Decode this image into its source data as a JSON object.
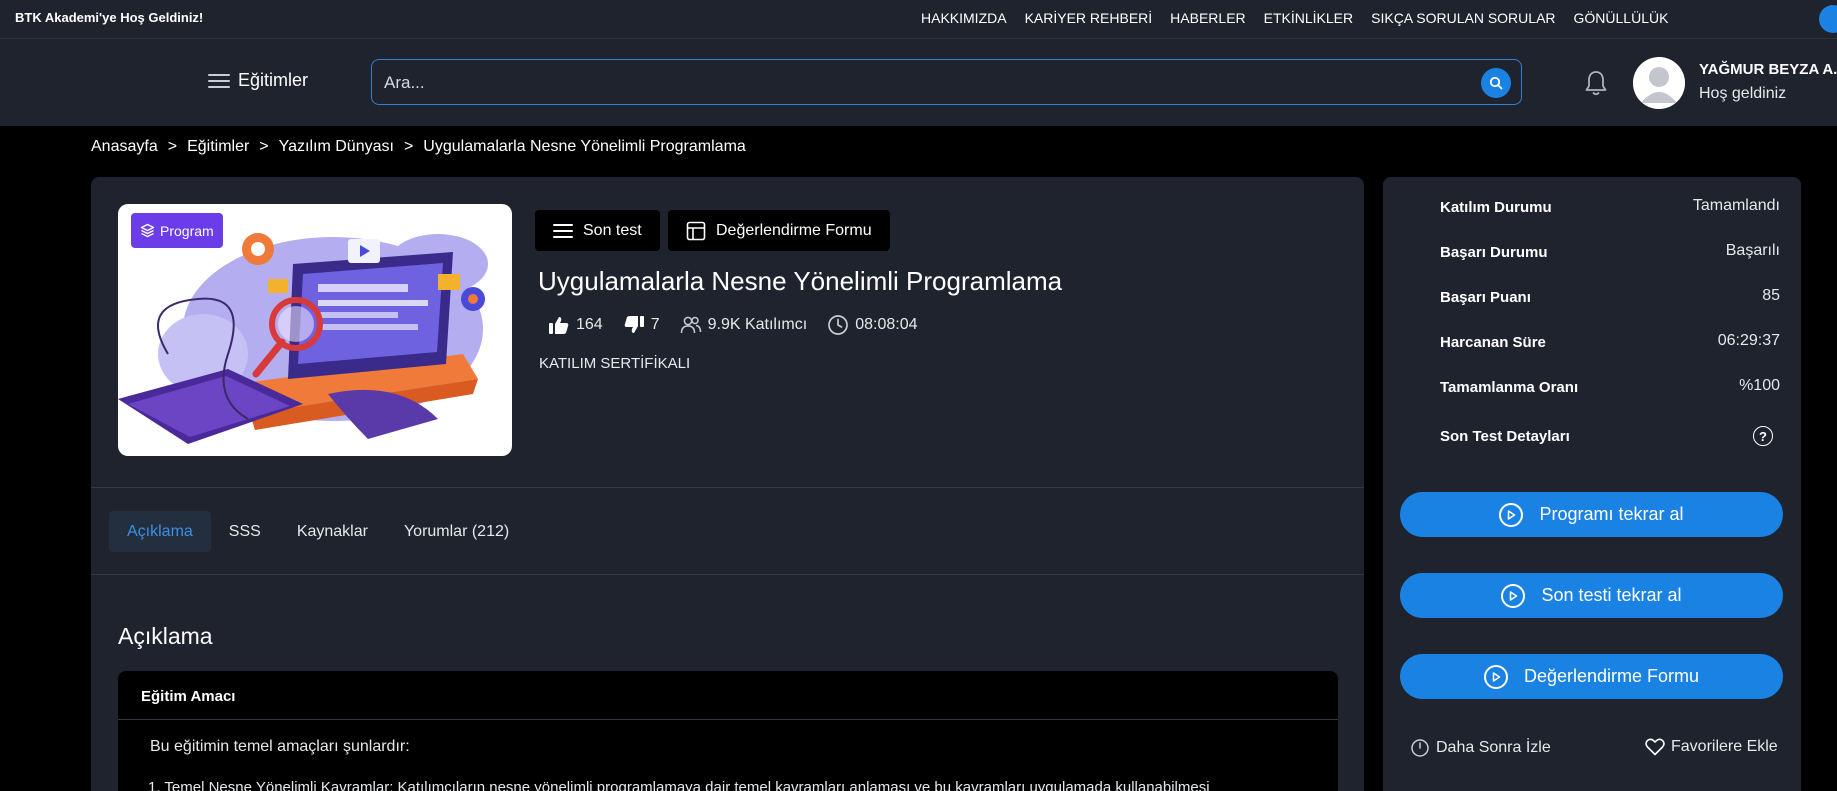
{
  "topbar": {
    "welcome": "BTK Akademi'ye Hoş Geldiniz!",
    "nav": [
      "HAKKIMIZDA",
      "KARİYER REHBERİ",
      "HABERLER",
      "ETKİNLİKLER",
      "SIKÇA SORULAN SORULAR",
      "GÖNÜLLÜLÜK"
    ]
  },
  "header": {
    "menu_label": "Eğitimler",
    "search_placeholder": "Ara...",
    "user_name": "YAĞMUR BEYZA A...",
    "user_greeting": "Hoş geldiniz"
  },
  "breadcrumb": [
    "Anasayfa",
    ">",
    "Eğitimler",
    ">",
    "Yazılım Dünyası",
    ">",
    "Uygulamalarla Nesne Yönelimli Programlama"
  ],
  "course": {
    "badge": "Program",
    "son_test_label": "Son test",
    "form_label": "Değerlendirme Formu",
    "title": "Uygulamalarla Nesne Yönelimli Programlama",
    "likes": "164",
    "dislikes": "7",
    "participants": "9.9K Katılımcı",
    "duration": "08:08:04",
    "certificate": "KATILIM SERTİFİKALI"
  },
  "tabs": [
    "Açıklama",
    "SSS",
    "Kaynaklar",
    "Yorumlar (212)"
  ],
  "description": {
    "heading": "Açıklama",
    "card_title": "Eğitim Amacı",
    "intro": "Bu eğitimin temel amaçları şunlardır:",
    "first_item": "1.  Temel Nesne Yönelimli Kavramlar: Katılımcıların nesne yönelimli programlamaya dair temel kavramları anlaması ve bu kavramları uygulamada kullanabilmesi"
  },
  "status": {
    "rows": [
      {
        "label": "Katılım Durumu",
        "value": "Tamamlandı"
      },
      {
        "label": "Başarı Durumu",
        "value": "Başarılı"
      },
      {
        "label": "Başarı Puanı",
        "value": "85"
      },
      {
        "label": "Harcanan Süre",
        "value": "06:29:37"
      },
      {
        "label": "Tamamlanma Oranı",
        "value": "%100"
      }
    ],
    "test_details_label": "Son Test Detayları",
    "help_icon": "?",
    "buttons": [
      "Programı tekrar al",
      "Son testi tekrar al",
      "Değerlendirme Formu"
    ],
    "watch_later": "Daha Sonra İzle",
    "favorites": "Favorilere Ekle"
  },
  "colors": {
    "accent": "#1a82e2",
    "panel": "#1e232d",
    "badge": "#6a3de8"
  }
}
